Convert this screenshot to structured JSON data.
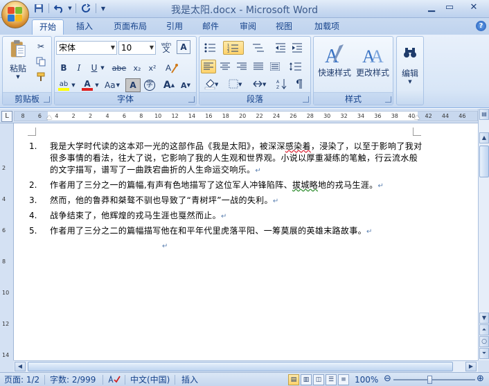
{
  "window": {
    "title": "我是太阳.docx - Microsoft Word"
  },
  "quick_access": {
    "save_icon": "save-icon",
    "undo_icon": "undo-icon",
    "redo_icon": "repeat-icon"
  },
  "tabs": [
    "开始",
    "插入",
    "页面布局",
    "引用",
    "邮件",
    "审阅",
    "视图",
    "加载项"
  ],
  "active_tab": "开始",
  "ribbon": {
    "clipboard": {
      "label": "剪贴板",
      "paste_label": "粘贴"
    },
    "font": {
      "label": "字体",
      "font_name": "宋体",
      "font_size": "10",
      "wen_glyph": "wén",
      "bold": "B",
      "italic": "I",
      "underline": "U",
      "strike": "abe",
      "subscript": "x₂",
      "superscript": "x²",
      "change_case": "Aa",
      "char_shade": "A",
      "enclose": "字",
      "grow": "A",
      "shrink": "A",
      "highlight": "ab",
      "font_color": "A"
    },
    "paragraph": {
      "label": "段落"
    },
    "styles": {
      "label": "样式",
      "quick_styles": "快速样式",
      "change_styles": "更改样式"
    },
    "editing": {
      "label": "编辑"
    }
  },
  "ruler": {
    "ticks": [
      "8",
      "6",
      "4",
      "2",
      "2",
      "4",
      "6",
      "8",
      "10",
      "12",
      "14",
      "16",
      "18",
      "20",
      "22",
      "24",
      "26",
      "28",
      "30",
      "32",
      "34",
      "36",
      "38",
      "40",
      "42",
      "44",
      "46"
    ],
    "vticks": [
      "2",
      "4",
      "6",
      "8",
      "10",
      "12",
      "14"
    ]
  },
  "document": {
    "items": [
      {
        "num": "1.",
        "text_a": "我是大学时代读的这本邓一光的这部作品《我是太阳》，被深深",
        "text_wavy": "感染着",
        "text_b": "，浸染了，以至于影响了我对很多事情的看法，往大了说，它影响了我的人生观和世界观。小说以厚重凝练的笔触，行云流水般的文字描写，谱写了一曲跌宕曲折的人生命运交响乐。"
      },
      {
        "num": "2.",
        "text_a": "作者用了三分之一的篇幅,有声有色地描写了这位军人冲锋陷阵、",
        "text_wavy": "拔城略",
        "text_b": "地的戎马生涯。"
      },
      {
        "num": "3.",
        "text_a": "然而，他的鲁莽和桀骜不驯也导致了“青树坪”一战的失利。",
        "text_wavy": "",
        "text_b": ""
      },
      {
        "num": "4.",
        "text_a": "战争结束了，他辉煌的戎马生涯也戛然而止。",
        "text_wavy": "",
        "text_b": ""
      },
      {
        "num": "5.",
        "text_a": "作者用了三分之二的篇幅描写他在和平年代里虎落平阳、一筹莫展的英雄末路故事。",
        "text_wavy": "",
        "text_b": ""
      }
    ],
    "paragraph_mark": "↵"
  },
  "status": {
    "page": "页面: 1/2",
    "words": "字数: 2/999",
    "language": "中文(中国)",
    "mode": "插入",
    "zoom": "100%"
  },
  "colors": {
    "accent": "#15428b",
    "ribbon_bg": "#dbe7f6",
    "highlight_yellow": "#ffff00",
    "font_color_red": "#e02020"
  }
}
